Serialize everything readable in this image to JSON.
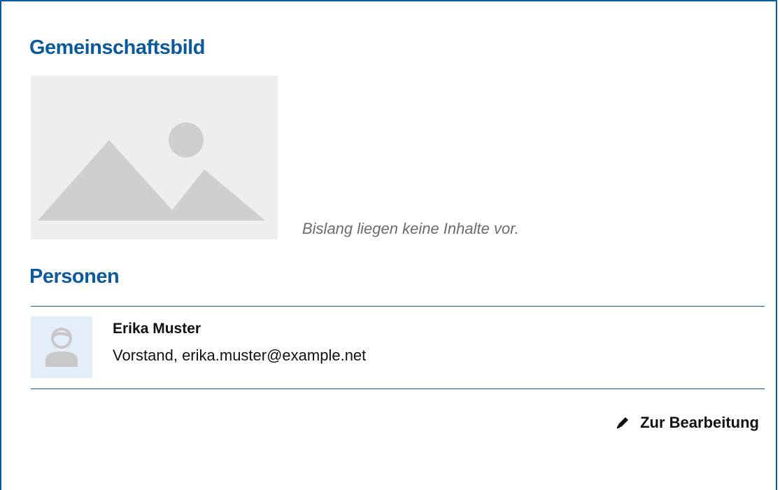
{
  "sections": {
    "community_image": {
      "title": "Gemeinschaftsbild",
      "empty_note": "Bislang liegen keine Inhalte vor.",
      "placeholder_icon": "image-placeholder-icon"
    },
    "persons": {
      "title": "Personen",
      "items": [
        {
          "name": "Erika Muster",
          "detail": "Vorstand, erika.muster@example.net",
          "avatar_icon": "person-avatar-icon"
        }
      ]
    }
  },
  "actions": {
    "edit_label": "Zur Bearbeitung",
    "edit_icon": "pencil-icon"
  },
  "colors": {
    "accent": "#0a5a9c",
    "placeholder_bg": "#eeeeee",
    "placeholder_shape": "#cfcfcf",
    "avatar_bg": "#e4eef8",
    "muted_text": "#6b6b6b"
  }
}
